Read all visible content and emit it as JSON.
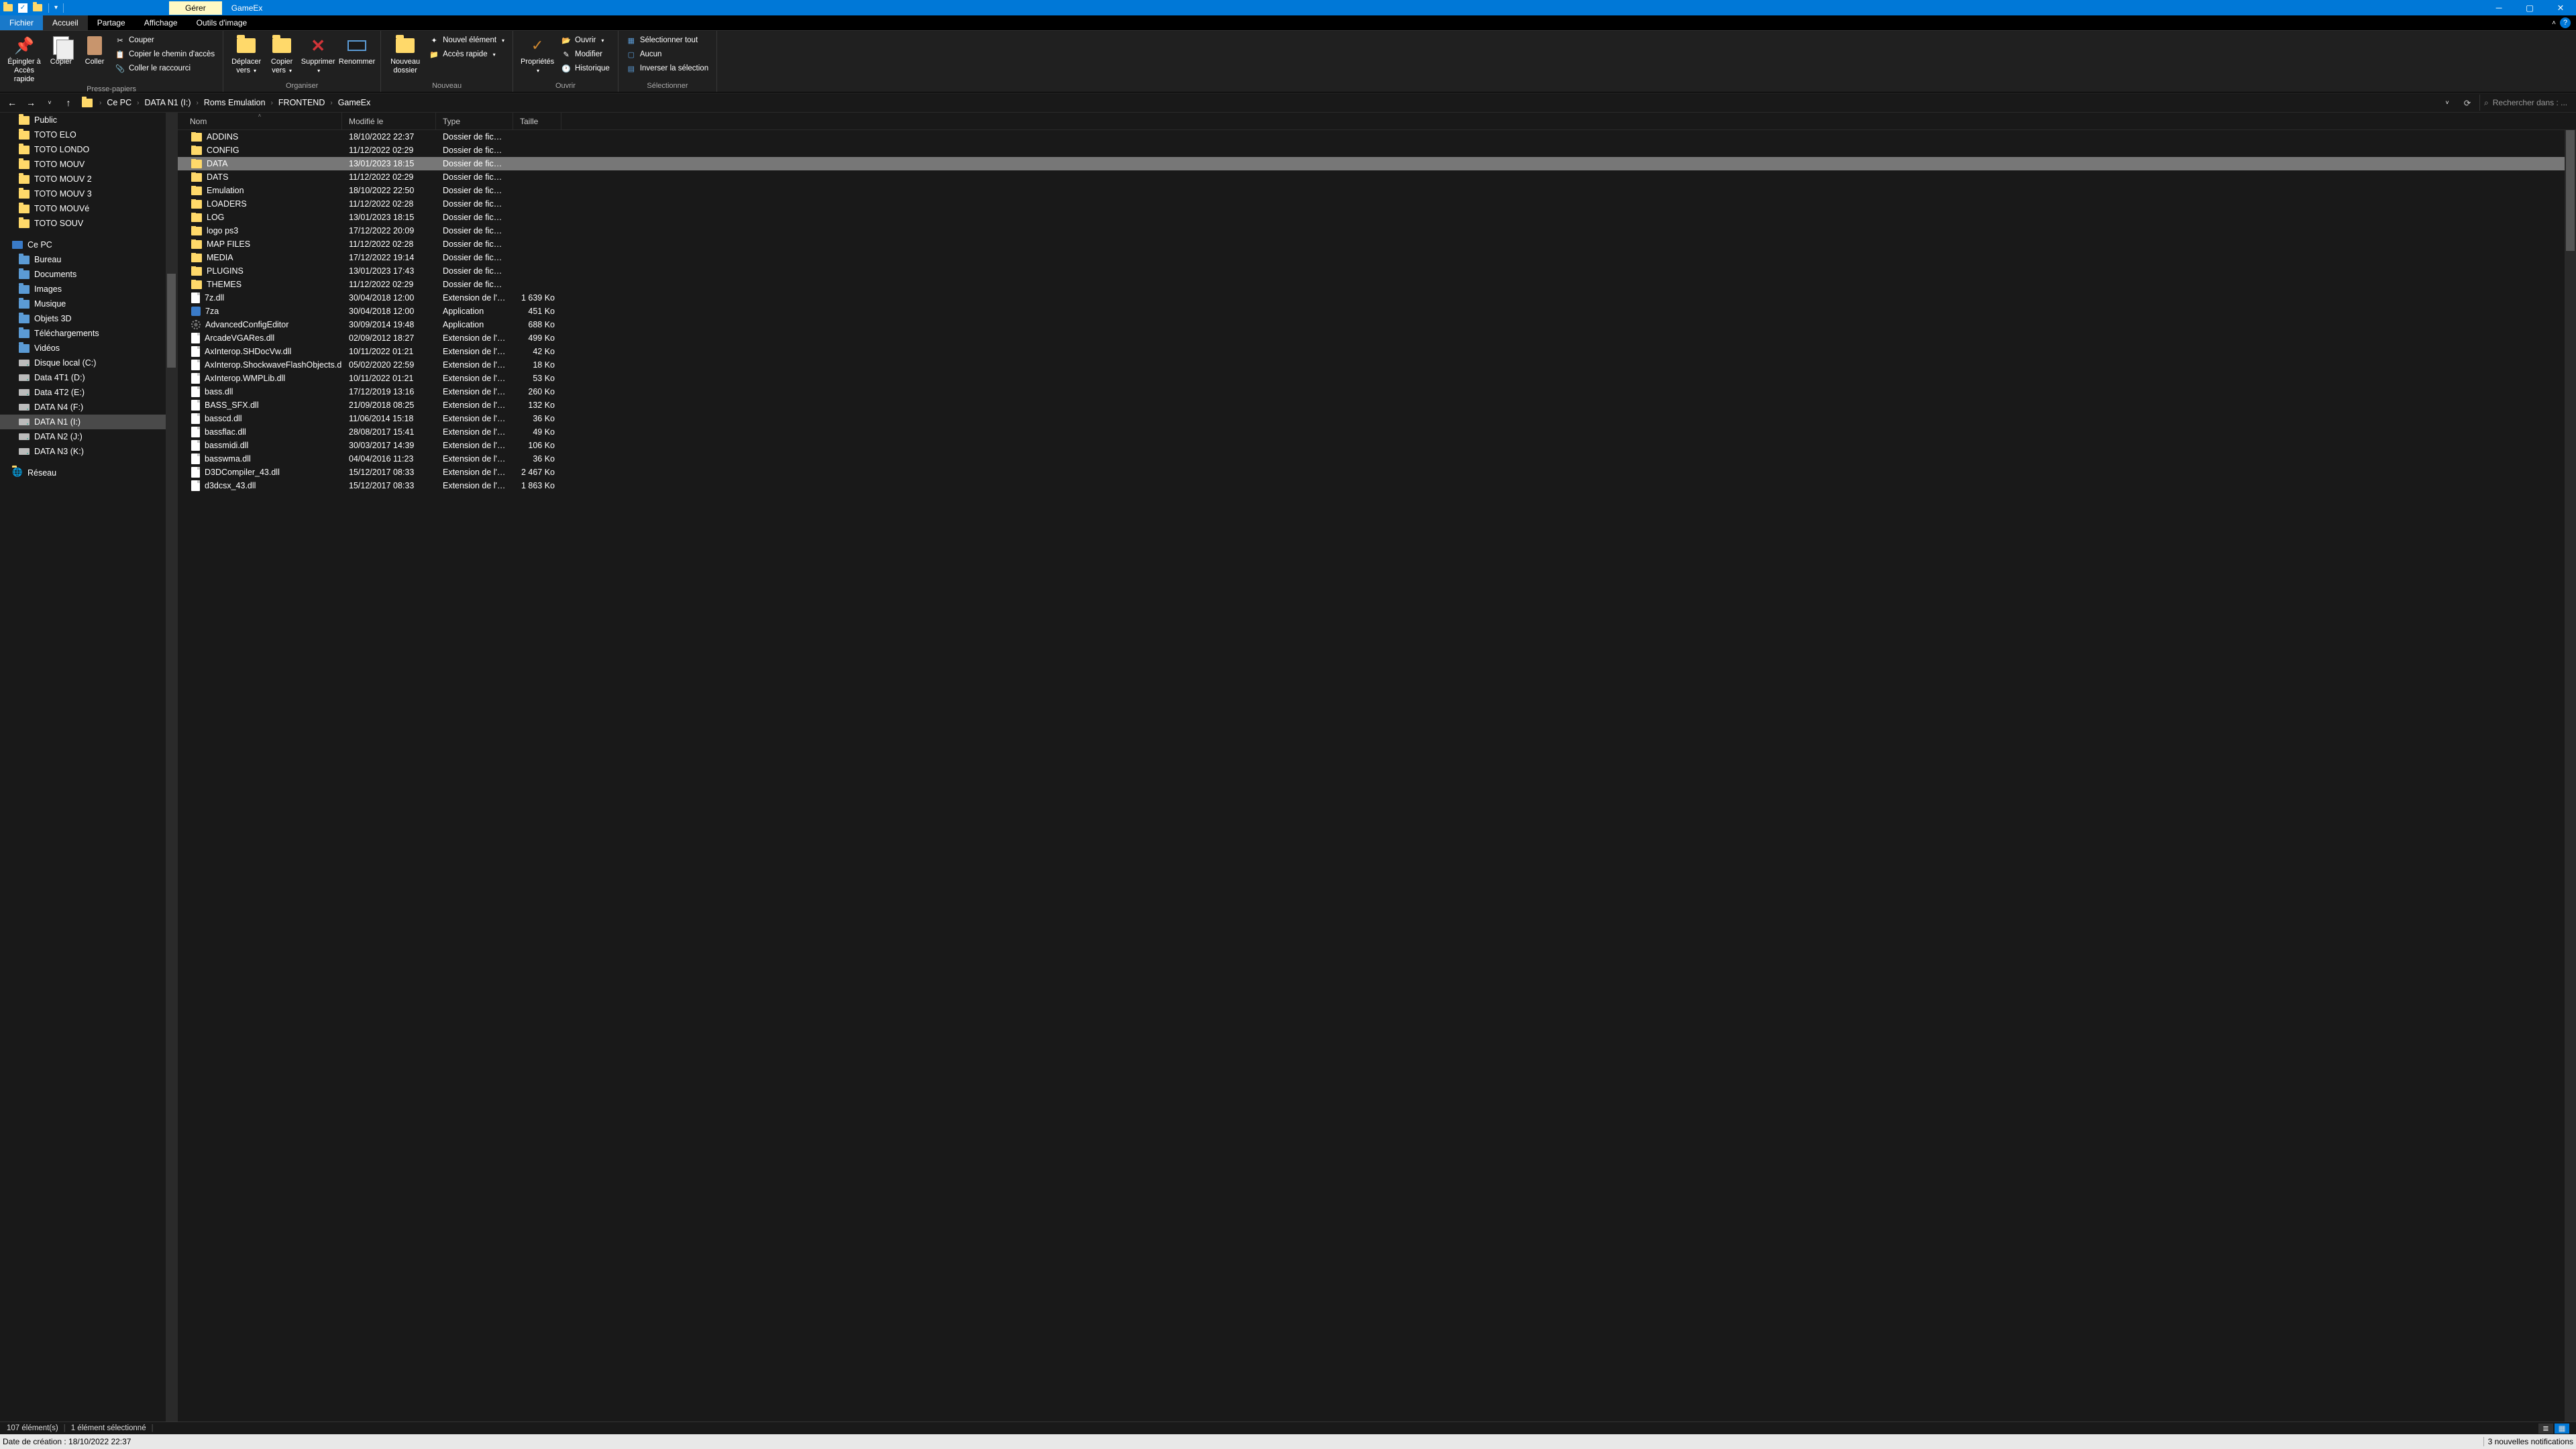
{
  "titlebar": {
    "manage": "Gérer",
    "title": "GameEx"
  },
  "tabs": {
    "file": "Fichier",
    "home": "Accueil",
    "share": "Partage",
    "view": "Affichage",
    "tools": "Outils d'image"
  },
  "ribbon": {
    "clipboard": {
      "pin": "Épingler à Accès rapide",
      "copy": "Copier",
      "paste": "Coller",
      "cut": "Couper",
      "copypath": "Copier le chemin d'accès",
      "pasteshortcut": "Coller le raccourci",
      "label": "Presse-papiers"
    },
    "organize": {
      "move": "Déplacer vers",
      "copyto": "Copier vers",
      "delete": "Supprimer",
      "rename": "Renommer",
      "label": "Organiser"
    },
    "new": {
      "newfolder": "Nouveau dossier",
      "newitem": "Nouvel élément",
      "easyaccess": "Accès rapide",
      "label": "Nouveau"
    },
    "open": {
      "properties": "Propriétés",
      "open": "Ouvrir",
      "edit": "Modifier",
      "history": "Historique",
      "label": "Ouvrir"
    },
    "select": {
      "selectall": "Sélectionner tout",
      "selectnone": "Aucun",
      "invert": "Inverser la sélection",
      "label": "Sélectionner"
    }
  },
  "breadcrumb": [
    "Ce PC",
    "DATA N1 (I:)",
    "Roms Emulation",
    "FRONTEND",
    "GameEx"
  ],
  "search_placeholder": "Rechercher dans : ...",
  "sidebar": [
    {
      "label": "Public",
      "icon": "folder",
      "level": 2
    },
    {
      "label": "TOTO ELO",
      "icon": "folder",
      "level": 2
    },
    {
      "label": "TOTO LONDO",
      "icon": "folder",
      "level": 2
    },
    {
      "label": "TOTO MOUV",
      "icon": "folder",
      "level": 2
    },
    {
      "label": "TOTO MOUV 2",
      "icon": "folder",
      "level": 2
    },
    {
      "label": "TOTO MOUV 3",
      "icon": "folder",
      "level": 2
    },
    {
      "label": "TOTO MOUVé",
      "icon": "folder",
      "level": 2
    },
    {
      "label": "TOTO SOUV",
      "icon": "folder",
      "level": 2
    },
    {
      "label": "",
      "spacer": true
    },
    {
      "label": "Ce PC",
      "icon": "pc",
      "level": 1
    },
    {
      "label": "Bureau",
      "icon": "lib",
      "level": 2
    },
    {
      "label": "Documents",
      "icon": "lib",
      "level": 2
    },
    {
      "label": "Images",
      "icon": "lib",
      "level": 2
    },
    {
      "label": "Musique",
      "icon": "lib",
      "level": 2
    },
    {
      "label": "Objets 3D",
      "icon": "lib",
      "level": 2
    },
    {
      "label": "Téléchargements",
      "icon": "lib",
      "level": 2
    },
    {
      "label": "Vidéos",
      "icon": "lib",
      "level": 2
    },
    {
      "label": "Disque local (C:)",
      "icon": "drive",
      "level": 2
    },
    {
      "label": "Data 4T1 (D:)",
      "icon": "drive",
      "level": 2
    },
    {
      "label": "Data 4T2 (E:)",
      "icon": "drive",
      "level": 2
    },
    {
      "label": "DATA N4 (F:)",
      "icon": "drive",
      "level": 2
    },
    {
      "label": "DATA N1 (I:)",
      "icon": "drive",
      "level": 2,
      "selected": true
    },
    {
      "label": "DATA N2 (J:)",
      "icon": "drive",
      "level": 2
    },
    {
      "label": "DATA N3 (K:)",
      "icon": "drive",
      "level": 2
    },
    {
      "label": "",
      "spacer": true
    },
    {
      "label": "Réseau",
      "icon": "net",
      "level": 1
    }
  ],
  "columns": {
    "name": "Nom",
    "modified": "Modifié le",
    "type": "Type",
    "size": "Taille"
  },
  "files": [
    {
      "name": "ADDINS",
      "mod": "18/10/2022 22:37",
      "type": "Dossier de fichiers",
      "size": "",
      "icon": "folder"
    },
    {
      "name": "CONFIG",
      "mod": "11/12/2022 02:29",
      "type": "Dossier de fichiers",
      "size": "",
      "icon": "folder"
    },
    {
      "name": "DATA",
      "mod": "13/01/2023 18:15",
      "type": "Dossier de fichiers",
      "size": "",
      "icon": "folder",
      "selected": true
    },
    {
      "name": "DATS",
      "mod": "11/12/2022 02:29",
      "type": "Dossier de fichiers",
      "size": "",
      "icon": "folder"
    },
    {
      "name": "Emulation",
      "mod": "18/10/2022 22:50",
      "type": "Dossier de fichiers",
      "size": "",
      "icon": "folder"
    },
    {
      "name": "LOADERS",
      "mod": "11/12/2022 02:28",
      "type": "Dossier de fichiers",
      "size": "",
      "icon": "folder"
    },
    {
      "name": "LOG",
      "mod": "13/01/2023 18:15",
      "type": "Dossier de fichiers",
      "size": "",
      "icon": "folder"
    },
    {
      "name": "logo ps3",
      "mod": "17/12/2022 20:09",
      "type": "Dossier de fichiers",
      "size": "",
      "icon": "folder"
    },
    {
      "name": "MAP FILES",
      "mod": "11/12/2022 02:28",
      "type": "Dossier de fichiers",
      "size": "",
      "icon": "folder"
    },
    {
      "name": "MEDIA",
      "mod": "17/12/2022 19:14",
      "type": "Dossier de fichiers",
      "size": "",
      "icon": "folder"
    },
    {
      "name": "PLUGINS",
      "mod": "13/01/2023 17:43",
      "type": "Dossier de fichiers",
      "size": "",
      "icon": "folder"
    },
    {
      "name": "THEMES",
      "mod": "11/12/2022 02:29",
      "type": "Dossier de fichiers",
      "size": "",
      "icon": "folder"
    },
    {
      "name": "7z.dll",
      "mod": "30/04/2018 12:00",
      "type": "Extension de l'app...",
      "size": "1 639 Ko",
      "icon": "file"
    },
    {
      "name": "7za",
      "mod": "30/04/2018 12:00",
      "type": "Application",
      "size": "451 Ko",
      "icon": "app"
    },
    {
      "name": "AdvancedConfigEditor",
      "mod": "30/09/2014 19:48",
      "type": "Application",
      "size": "688 Ko",
      "icon": "gear"
    },
    {
      "name": "ArcadeVGARes.dll",
      "mod": "02/09/2012 18:27",
      "type": "Extension de l'app...",
      "size": "499 Ko",
      "icon": "file"
    },
    {
      "name": "AxInterop.SHDocVw.dll",
      "mod": "10/11/2022 01:21",
      "type": "Extension de l'app...",
      "size": "42 Ko",
      "icon": "file"
    },
    {
      "name": "AxInterop.ShockwaveFlashObjects.dll",
      "mod": "05/02/2020 22:59",
      "type": "Extension de l'app...",
      "size": "18 Ko",
      "icon": "file"
    },
    {
      "name": "AxInterop.WMPLib.dll",
      "mod": "10/11/2022 01:21",
      "type": "Extension de l'app...",
      "size": "53 Ko",
      "icon": "file"
    },
    {
      "name": "bass.dll",
      "mod": "17/12/2019 13:16",
      "type": "Extension de l'app...",
      "size": "260 Ko",
      "icon": "file"
    },
    {
      "name": "BASS_SFX.dll",
      "mod": "21/09/2018 08:25",
      "type": "Extension de l'app...",
      "size": "132 Ko",
      "icon": "file"
    },
    {
      "name": "basscd.dll",
      "mod": "11/06/2014 15:18",
      "type": "Extension de l'app...",
      "size": "36 Ko",
      "icon": "file"
    },
    {
      "name": "bassflac.dll",
      "mod": "28/08/2017 15:41",
      "type": "Extension de l'app...",
      "size": "49 Ko",
      "icon": "file"
    },
    {
      "name": "bassmidi.dll",
      "mod": "30/03/2017 14:39",
      "type": "Extension de l'app...",
      "size": "106 Ko",
      "icon": "file"
    },
    {
      "name": "basswma.dll",
      "mod": "04/04/2016 11:23",
      "type": "Extension de l'app...",
      "size": "36 Ko",
      "icon": "file"
    },
    {
      "name": "D3DCompiler_43.dll",
      "mod": "15/12/2017 08:33",
      "type": "Extension de l'app...",
      "size": "2 467 Ko",
      "icon": "file"
    },
    {
      "name": "d3dcsx_43.dll",
      "mod": "15/12/2017 08:33",
      "type": "Extension de l'app...",
      "size": "1 863 Ko",
      "icon": "file"
    }
  ],
  "status": {
    "count": "107 élément(s)",
    "selected": "1 élément sélectionné"
  },
  "info": {
    "left": "Date de création : 18/10/2022 22:37",
    "right": "3 nouvelles notifications"
  }
}
